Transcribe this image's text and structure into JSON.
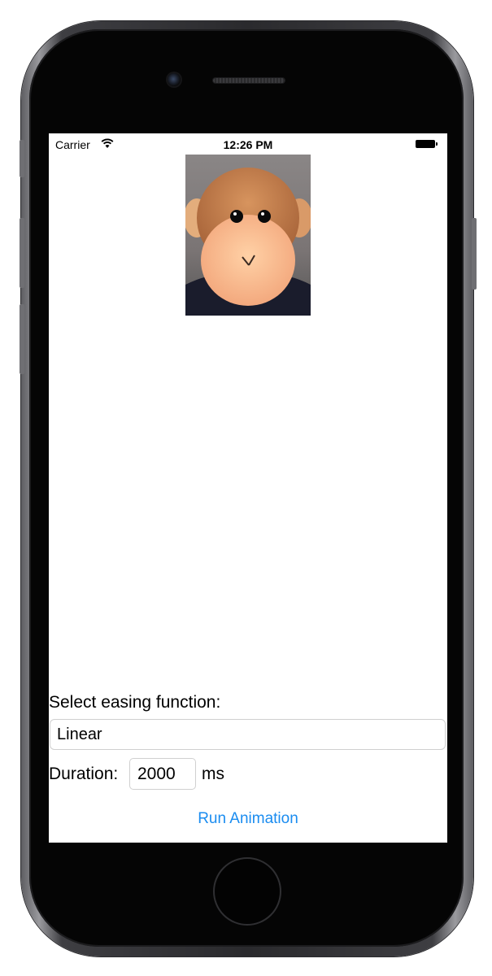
{
  "status_bar": {
    "carrier": "Carrier",
    "time": "12:26 PM",
    "wifi_icon": "wifi-icon",
    "battery_icon": "battery-full-icon"
  },
  "image": {
    "description_icon": "monkey-plush-photo"
  },
  "easing": {
    "label": "Select easing function:",
    "selected": "Linear"
  },
  "duration": {
    "label": "Duration:",
    "value": "2000",
    "unit": "ms"
  },
  "actions": {
    "run_label": "Run Animation"
  },
  "colors": {
    "accent": "#1a8cf0",
    "screen_bg": "#ffffff",
    "device_bezel": "#050505"
  }
}
